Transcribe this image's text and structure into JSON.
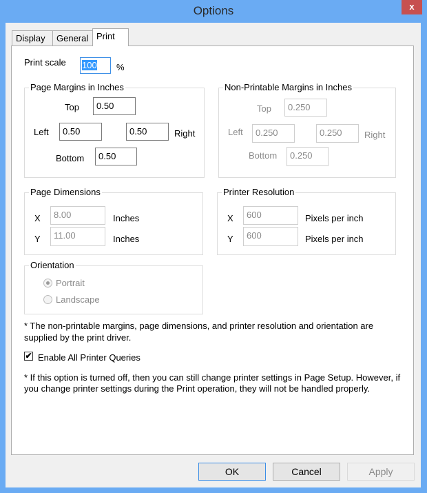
{
  "window": {
    "title": "Options",
    "close": "x"
  },
  "tabs": [
    "Display",
    "General",
    "Print"
  ],
  "print_scale": {
    "label": "Print scale",
    "value": "100",
    "unit": "%"
  },
  "page_margins": {
    "title": "Page Margins in Inches",
    "top_label": "Top",
    "top": "0.50",
    "left_label": "Left",
    "left": "0.50",
    "right": "0.50",
    "right_label": "Right",
    "bottom_label": "Bottom",
    "bottom": "0.50"
  },
  "nonprint_margins": {
    "title": "Non-Printable Margins in Inches",
    "top_label": "Top",
    "top": "0.250",
    "left_label": "Left",
    "left": "0.250",
    "right": "0.250",
    "right_label": "Right",
    "bottom_label": "Bottom",
    "bottom": "0.250"
  },
  "page_dimensions": {
    "title": "Page Dimensions",
    "x_label": "X",
    "x": "8.00",
    "x_unit": "Inches",
    "y_label": "Y",
    "y": "11.00",
    "y_unit": "Inches"
  },
  "printer_resolution": {
    "title": "Printer Resolution",
    "x_label": "X",
    "x": "600",
    "x_unit": "Pixels per inch",
    "y_label": "Y",
    "y": "600",
    "y_unit": "Pixels per inch"
  },
  "orientation": {
    "title": "Orientation",
    "portrait": "Portrait",
    "landscape": "Landscape",
    "selected": "Portrait"
  },
  "note1": "* The non-printable margins, page dimensions, and printer resolution and orientation are supplied by the print driver.",
  "enable_queries": {
    "label": "Enable All Printer Queries",
    "checked": true
  },
  "note2": "* If this option is turned off, then you can still change printer settings in Page Setup.  However, if you change printer settings during the Print operation, they will not be handled properly.",
  "buttons": {
    "ok": "OK",
    "cancel": "Cancel",
    "apply": "Apply"
  }
}
